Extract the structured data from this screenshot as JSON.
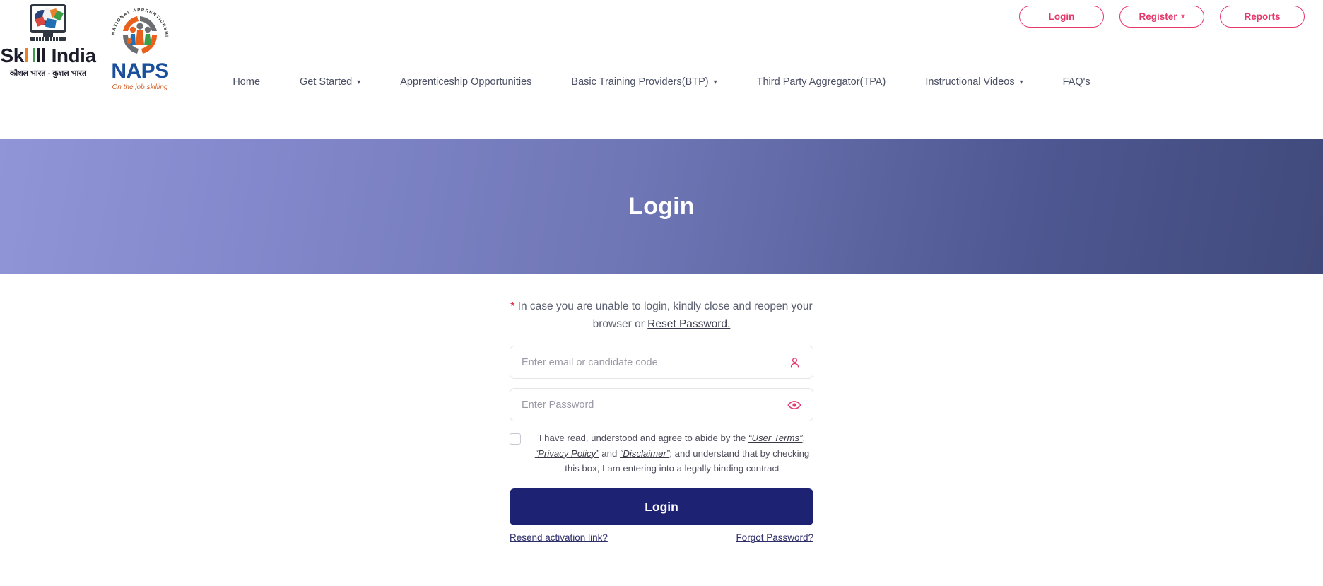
{
  "header": {
    "logos": [
      {
        "name": "skill-india",
        "word": "Sk",
        "word2": "ll India",
        "subtitle": "कौशल भारत - कुशल भारत"
      },
      {
        "name": "naps",
        "text": "NAPS",
        "tagline": "On the job skilling",
        "ring_text": "NATIONAL APPRENTICESHIP PROMOTION SCHEME"
      }
    ],
    "top_actions": [
      {
        "label": "Login",
        "caret": false
      },
      {
        "label": "Register",
        "caret": true
      },
      {
        "label": "Reports",
        "caret": false
      }
    ],
    "nav": [
      {
        "label": "Home",
        "caret": false
      },
      {
        "label": "Get Started",
        "caret": true
      },
      {
        "label": "Apprenticeship Opportunities",
        "caret": false
      },
      {
        "label": "Basic Training Providers(BTP)",
        "caret": true
      },
      {
        "label": "Third Party Aggregator(TPA)",
        "caret": false
      },
      {
        "label": "Instructional Videos",
        "caret": true
      },
      {
        "label": "FAQ's",
        "caret": false
      }
    ]
  },
  "banner": {
    "title": "Login"
  },
  "form": {
    "notice": {
      "star": "*",
      "text_before": " In case you are unable to login, kindly close and reopen your browser or ",
      "link": "Reset Password."
    },
    "email": {
      "placeholder": "Enter email or candidate code",
      "value": "",
      "icon": "user-icon"
    },
    "password": {
      "placeholder": "Enter Password",
      "value": "",
      "icon": "eye-icon"
    },
    "terms": {
      "checked": false,
      "part1": "I have read, understood and agree to abide by the ",
      "link1": "“User Terms”",
      "part2": ", ",
      "link2": "“Privacy Policy”",
      "part3": " and ",
      "link3": "“Disclaimer”",
      "part4": "; and understand that by checking this box, I am entering into a legally binding contract"
    },
    "submit_label": "Login",
    "resend_label": "Resend activation link?",
    "forgot_label": "Forgot Password?"
  },
  "colors": {
    "accent_pink": "#e5386b",
    "banner_start": "#8f95d6",
    "banner_end": "#414a7b",
    "button_navy": "#1d2272",
    "link_navy": "#2e2e6b",
    "asterisk_red": "#e23c4e"
  }
}
